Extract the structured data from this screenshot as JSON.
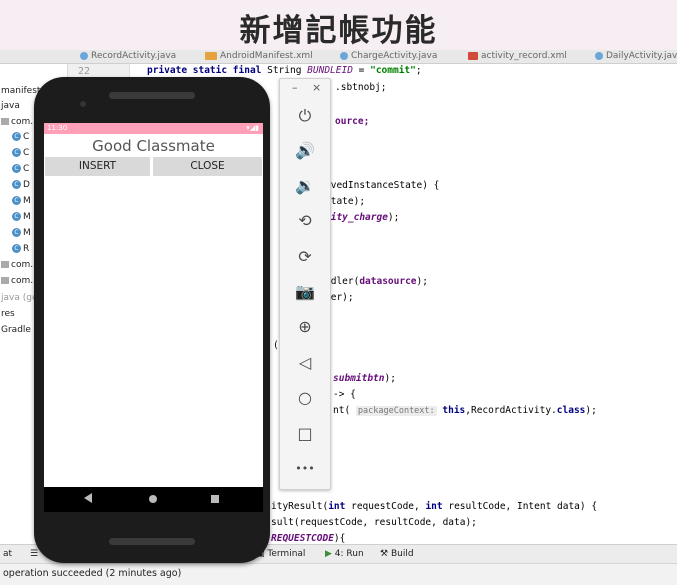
{
  "slide": {
    "title": "新增記帳功能"
  },
  "ide": {
    "tabs": [
      "RecordActivity.java",
      "AndroidManifest.xml",
      "ChargeActivity.java",
      "activity_record.xml",
      "DailyActivity.java"
    ],
    "line_number": "22",
    "project_tree": [
      {
        "label": "manifests",
        "icon": "folder-icon"
      },
      {
        "label": "java",
        "icon": "folder-icon"
      },
      {
        "label": "com.",
        "icon": "package-icon"
      },
      {
        "label": "C",
        "icon": "class-icon"
      },
      {
        "label": "C",
        "icon": "class-icon"
      },
      {
        "label": "C",
        "icon": "class-icon"
      },
      {
        "label": "D",
        "icon": "class-icon"
      },
      {
        "label": "M",
        "icon": "class-icon"
      },
      {
        "label": "M",
        "icon": "class-icon"
      },
      {
        "label": "M",
        "icon": "class-icon"
      },
      {
        "label": "R",
        "icon": "class-icon"
      },
      {
        "label": "com.",
        "icon": "package-icon"
      },
      {
        "label": "com.",
        "icon": "package-icon"
      },
      {
        "label": "java (ge",
        "icon": "folder-icon"
      },
      {
        "label": "res",
        "icon": "folder-icon"
      },
      {
        "label": "Gradle Scrip",
        "icon": "gradle-icon"
      }
    ],
    "code": {
      "l1_a": "private static final ",
      "l1_b": "String ",
      "l1_c": "BUNDLEID",
      "l1_d": " = ",
      "l1_e": "\"commit\"",
      "l1_f": ";",
      "l2": ".sbtnobj;",
      "l3": "ource;",
      "l4": "avedInstanceState) {",
      "l5": "State);",
      "l6_a": "vity_charge",
      "l6_b": ");",
      "l7_a": "ndler(",
      "l7_b": "datasource",
      "l7_c": ");",
      "l8": "ler);",
      "l9": "(",
      "l10_a": "submitbtn",
      "l10_b": ");",
      "l11": "-> {",
      "l12_a": "nt( ",
      "l12_hint": "packageContext:",
      "l12_b": " this",
      "l12_c": ",RecordActivity.",
      "l12_d": "class",
      "l12_e": ");",
      "l13_a": "ityResult(",
      "l13_b": "int",
      "l13_c": " requestCode, ",
      "l13_d": "int",
      "l13_e": " resultCode, Intent data) {",
      "l14": "sult(requestCode, resultCode, data);",
      "l15_a": "REQUESTCODE",
      "l15_b": "){"
    },
    "bottom_bar": {
      "left_label": "at",
      "terminal": "Terminal",
      "run": "4: Run",
      "build": "Build"
    },
    "status": "operation succeeded (2 minutes ago)"
  },
  "emulator": {
    "toolbar": {
      "minimize": "–",
      "close": "×",
      "tools": [
        {
          "icon": "power-icon",
          "glyph": "⏻"
        },
        {
          "icon": "volume-up-icon",
          "glyph": "🔊"
        },
        {
          "icon": "volume-down-icon",
          "glyph": "🔉"
        },
        {
          "icon": "rotate-left-icon",
          "glyph": "⟲"
        },
        {
          "icon": "rotate-right-icon",
          "glyph": "⟳"
        },
        {
          "icon": "camera-icon",
          "glyph": "📷"
        },
        {
          "icon": "zoom-icon",
          "glyph": "⊕"
        },
        {
          "icon": "back-icon",
          "glyph": "◁"
        },
        {
          "icon": "home-icon",
          "glyph": "○"
        },
        {
          "icon": "overview-icon",
          "glyph": "□"
        },
        {
          "icon": "more-icon",
          "glyph": "•••"
        }
      ]
    },
    "phone": {
      "status_time": "11:30",
      "app_title": "Good Classmate",
      "insert_label": "INSERT",
      "close_label": "CLOSE"
    }
  }
}
